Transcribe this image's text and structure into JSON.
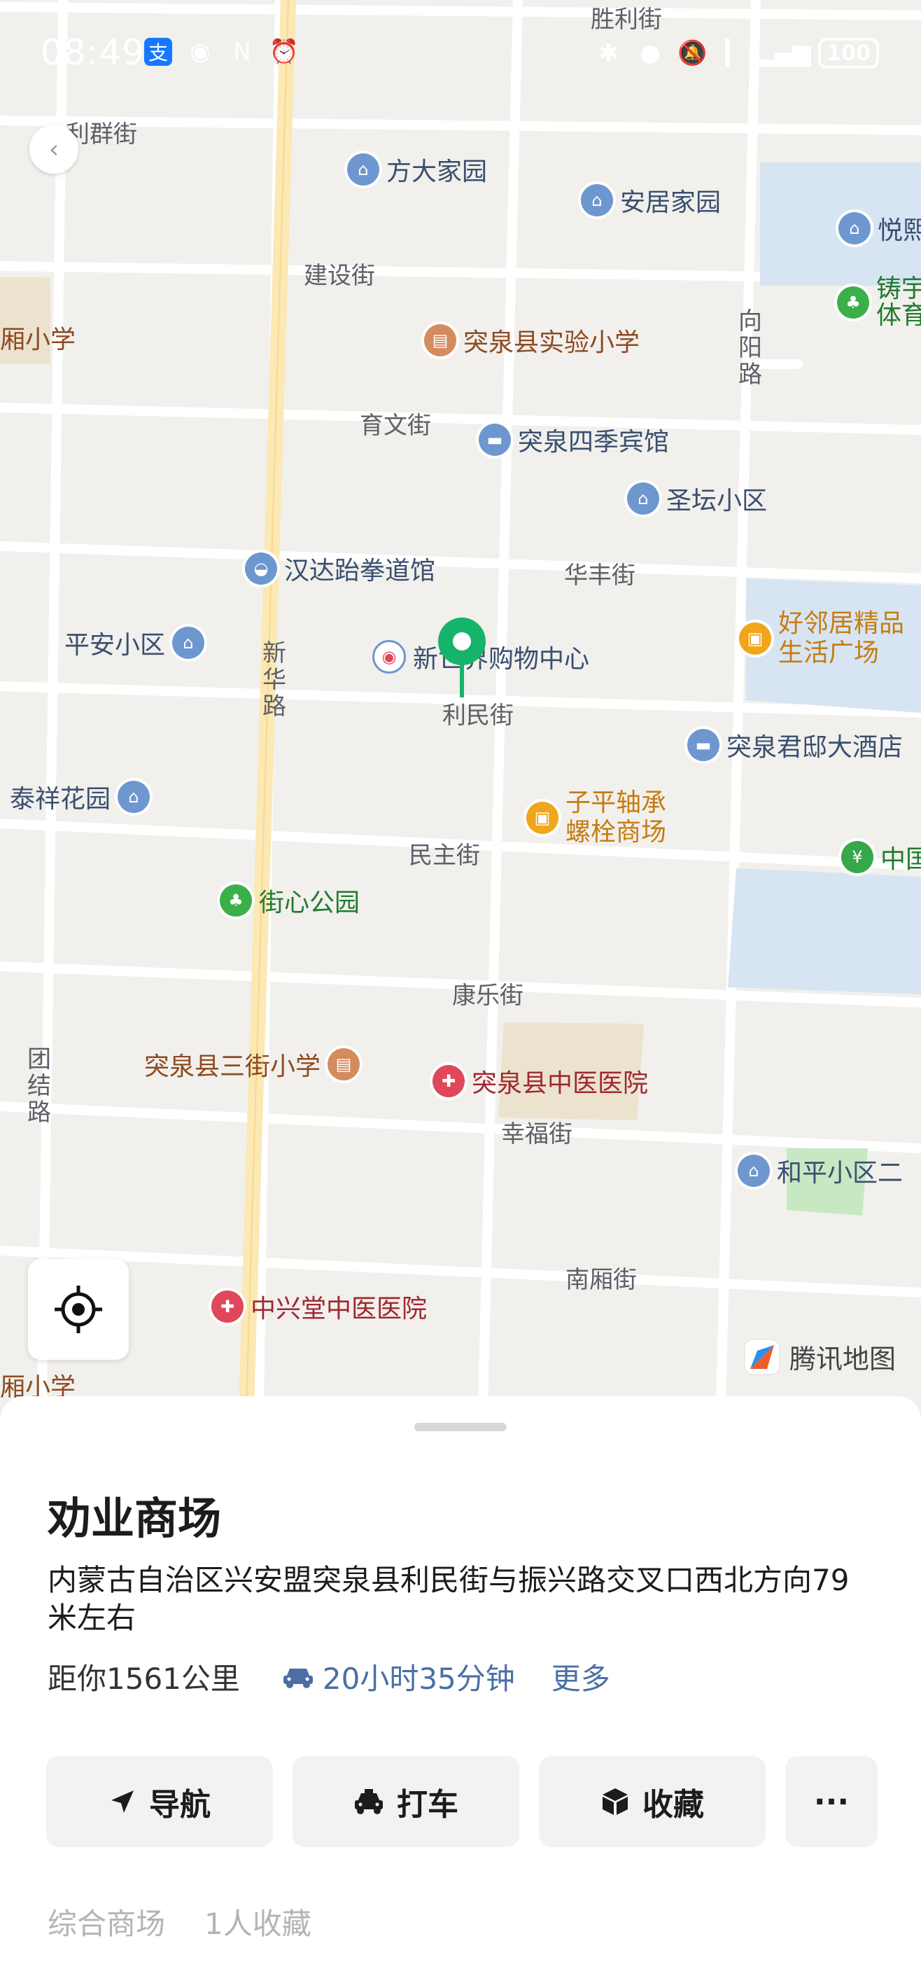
{
  "status_bar": {
    "time": "08:49",
    "battery": "100"
  },
  "map": {
    "streets": {
      "lichun": "胜利街",
      "liqun": "利群街",
      "jianshe": "建设街",
      "yuwen": "育文街",
      "huafeng": "华丰街",
      "limin": "利民街",
      "minzhu": "民主街",
      "kangle": "康乐街",
      "xingfu": "幸福街",
      "nanxiang": "南厢街",
      "xianghang": "向阳路",
      "xinhua": "新华路",
      "tuanjie": "团结路"
    },
    "pois": {
      "fangda": "方大家园",
      "anju": "安居家园",
      "yuexiang": "悦熙",
      "zhuyu": "铸宇",
      "tiyu": "体育",
      "xiangxiao_left": "厢小学",
      "shiyan": "突泉县实验小学",
      "siji": "突泉四季宾馆",
      "shengtan": "圣坛小区",
      "handa": "汉达跆拳道馆",
      "pingan": "平安小区",
      "xinshijie": "新世界购物中心",
      "haolinju": "好邻居精品",
      "shenghuo": "生活广场",
      "junyuan": "突泉君邸大酒店",
      "taixiang": "泰祥花园",
      "ziping1": "子平轴承",
      "ziping2": "螺栓商场",
      "zhongguo": "中国",
      "jiexin": "街心公园",
      "sanjie": "突泉县三街小学",
      "zhongyi": "突泉县中医医院",
      "heping": "和平小区二",
      "zhongxingtang": "中兴堂中医医院",
      "xiangxiao_bottom": "厢小学"
    },
    "logo": "腾讯地图"
  },
  "place": {
    "name": "劝业商场",
    "address": "内蒙古自治区兴安盟突泉县利民街与振兴路交叉口西北方向79米左右",
    "distance": "距你1561公里",
    "drive_time": "20小时35分钟",
    "more": "更多"
  },
  "actions": {
    "navigate": "导航",
    "taxi": "打车",
    "favorite": "收藏",
    "more": "···"
  },
  "tags": {
    "category": "综合商场",
    "favorites": "1人收藏"
  }
}
